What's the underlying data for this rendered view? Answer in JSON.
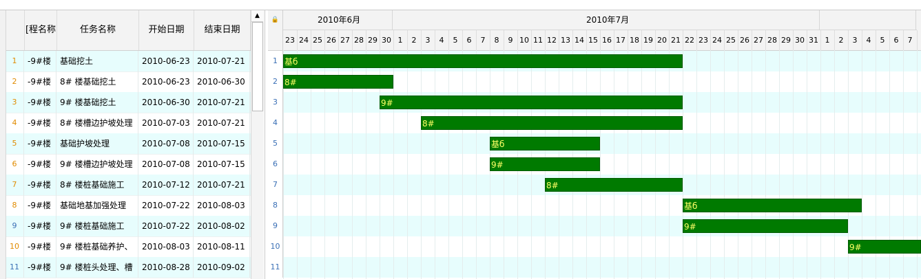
{
  "task_grid": {
    "columns": [
      "[程名称",
      "任务名称",
      "开始日期",
      "结束日期"
    ],
    "rows": [
      {
        "num": "1",
        "project": "-9#楼",
        "task": "基础挖土",
        "start": "2010-06-23",
        "end": "2010-07-21"
      },
      {
        "num": "2",
        "project": "-9#楼",
        "task": "8# 楼基础挖土",
        "start": "2010-06-23",
        "end": "2010-06-30"
      },
      {
        "num": "3",
        "project": "-9#楼",
        "task": "9# 楼基础挖土",
        "start": "2010-06-30",
        "end": "2010-07-21"
      },
      {
        "num": "4",
        "project": "-9#楼",
        "task": "8# 楼槽边护坡处理",
        "start": "2010-07-03",
        "end": "2010-07-21"
      },
      {
        "num": "5",
        "project": "-9#楼",
        "task": "基础护坡处理",
        "start": "2010-07-08",
        "end": "2010-07-15"
      },
      {
        "num": "6",
        "project": "-9#楼",
        "task": "9# 楼槽边护坡处理",
        "start": "2010-07-08",
        "end": "2010-07-15"
      },
      {
        "num": "7",
        "project": "-9#楼",
        "task": "8# 楼桩基础施工",
        "start": "2010-07-12",
        "end": "2010-07-21"
      },
      {
        "num": "8",
        "project": "-9#楼",
        "task": "基础地基加强处理",
        "start": "2010-07-22",
        "end": "2010-08-03"
      },
      {
        "num": "9",
        "project": "-9#楼",
        "task": "9# 楼桩基础施工",
        "start": "2010-07-22",
        "end": "2010-08-02"
      },
      {
        "num": "10",
        "project": "-9#楼",
        "task": "9# 楼桩基础养护、",
        "start": "2010-08-03",
        "end": "2010-08-11"
      },
      {
        "num": "11",
        "project": "-9#楼",
        "task": "9# 楼桩头处理、槽",
        "start": "2010-08-28",
        "end": "2010-09-02"
      }
    ]
  },
  "chart_data": {
    "type": "gantt",
    "months": [
      {
        "label": "2010年6月",
        "days": [
          "23",
          "24",
          "25",
          "26",
          "27",
          "28",
          "29",
          "30"
        ]
      },
      {
        "label": "2010年7月",
        "days": [
          "1",
          "2",
          "3",
          "4",
          "5",
          "6",
          "7",
          "8",
          "9",
          "10",
          "11",
          "12",
          "13",
          "14",
          "15",
          "16",
          "17",
          "18",
          "19",
          "20",
          "21",
          "22",
          "23",
          "24",
          "25",
          "26",
          "27",
          "28",
          "29",
          "30",
          "31"
        ]
      },
      {
        "label": "",
        "days": [
          "1",
          "2",
          "3",
          "4",
          "5",
          "6",
          "7"
        ]
      }
    ],
    "tasks": [
      {
        "row": "1",
        "start": "2010-06-23",
        "end": "2010-07-21",
        "bar_label": "基б"
      },
      {
        "row": "2",
        "start": "2010-06-23",
        "end": "2010-06-30",
        "bar_label": "8#"
      },
      {
        "row": "3",
        "start": "2010-06-30",
        "end": "2010-07-21",
        "bar_label": "9#"
      },
      {
        "row": "4",
        "start": "2010-07-03",
        "end": "2010-07-21",
        "bar_label": "8#"
      },
      {
        "row": "5",
        "start": "2010-07-08",
        "end": "2010-07-15",
        "bar_label": "基б"
      },
      {
        "row": "6",
        "start": "2010-07-08",
        "end": "2010-07-15",
        "bar_label": "9#"
      },
      {
        "row": "7",
        "start": "2010-07-12",
        "end": "2010-07-21",
        "bar_label": "8#"
      },
      {
        "row": "8",
        "start": "2010-07-22",
        "end": "2010-08-03",
        "bar_label": "基б"
      },
      {
        "row": "9",
        "start": "2010-07-22",
        "end": "2010-08-02",
        "bar_label": "9#"
      },
      {
        "row": "10",
        "start": "2010-08-03",
        "end": "2010-08-11",
        "bar_label": "9#"
      },
      {
        "row": "11",
        "start": "2010-08-28",
        "end": "2010-09-02",
        "bar_label": ""
      }
    ],
    "bar_color": "#007a00",
    "bar_text_color": "#ffff66",
    "alt_row_color": "#e7fdfd"
  }
}
